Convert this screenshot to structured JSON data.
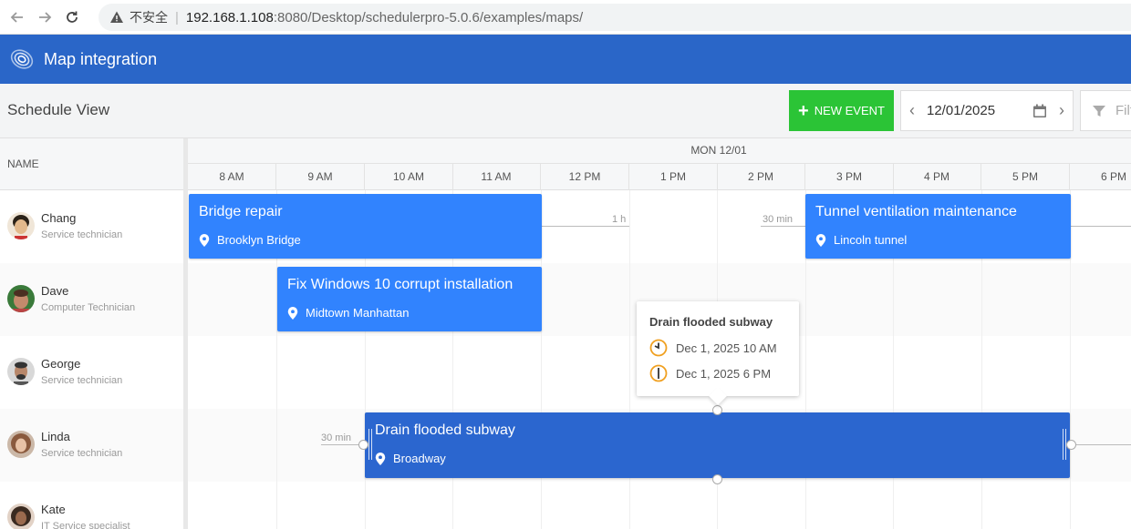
{
  "browser": {
    "insecure_label": "不安全",
    "url_host": "192.168.1.108",
    "url_rest": ":8080/Desktop/schedulerpro-5.0.6/examples/maps/"
  },
  "header": {
    "title": "Map integration"
  },
  "toolbar": {
    "view_title": "Schedule View",
    "new_event_label": "NEW EVENT",
    "date_value": "12/01/2025",
    "filter_placeholder": "Filt"
  },
  "grid": {
    "name_header": "NAME",
    "day_label": "MON 12/01",
    "hours": [
      "8 AM",
      "9 AM",
      "10 AM",
      "11 AM",
      "12 PM",
      "1 PM",
      "2 PM",
      "3 PM",
      "4 PM",
      "5 PM",
      "6 PM"
    ],
    "resources": [
      {
        "name": "Chang",
        "role": "Service technician"
      },
      {
        "name": "Dave",
        "role": "Computer Technician"
      },
      {
        "name": "George",
        "role": "Service technician"
      },
      {
        "name": "Linda",
        "role": "Service technician"
      },
      {
        "name": "Kate",
        "role": "IT Service specialist"
      }
    ]
  },
  "events": [
    {
      "title": "Bridge repair",
      "location": "Brooklyn Bridge"
    },
    {
      "title": "Tunnel ventilation maintenance",
      "location": "Lincoln tunnel"
    },
    {
      "title": "Fix Windows 10 corrupt installation",
      "location": "Midtown Manhattan"
    },
    {
      "title": "Drain flooded subway",
      "location": "Broadway"
    }
  ],
  "buffers": {
    "b1": "1 h",
    "b2": "30 min",
    "b3": "30 min"
  },
  "tooltip": {
    "title": "Drain flooded subway",
    "start": "Dec 1, 2025 10 AM",
    "end": "Dec 1, 2025 6 PM"
  },
  "colors": {
    "header_bg": "#2a66c8",
    "event_bg": "#3183fe",
    "event_selected_bg": "#2b66cf",
    "new_event_bg": "#2bc436",
    "tooltip_icon": "#f0a020"
  }
}
